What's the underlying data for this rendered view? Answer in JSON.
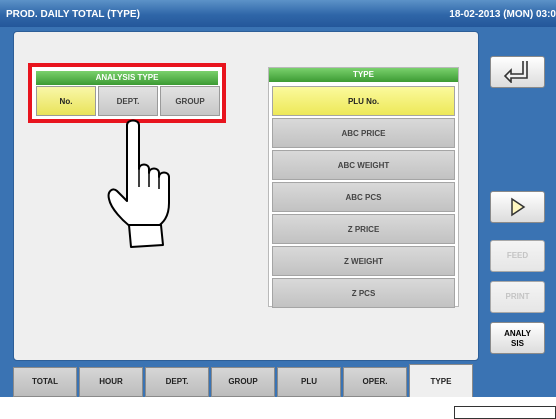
{
  "title": "PROD. DAILY TOTAL (TYPE)",
  "datetime": "18-02-2013 (MON) 03:0",
  "analysis": {
    "header": "ANALYSIS TYPE",
    "options": [
      {
        "label": "No.",
        "selected": true
      },
      {
        "label": "DEPT.",
        "selected": false
      },
      {
        "label": "GROUP",
        "selected": false
      }
    ]
  },
  "type_list": {
    "header": "TYPE",
    "items": [
      {
        "label": "PLU No.",
        "selected": true
      },
      {
        "label": "ABC PRICE",
        "selected": false
      },
      {
        "label": "ABC WEIGHT",
        "selected": false
      },
      {
        "label": "ABC PCS",
        "selected": false
      },
      {
        "label": "Z PRICE",
        "selected": false
      },
      {
        "label": "Z WEIGHT",
        "selected": false
      },
      {
        "label": "Z PCS",
        "selected": false
      }
    ]
  },
  "right_buttons": {
    "back_icon": "return-arrow-icon",
    "next_icon": "play-arrow-icon",
    "feed": "FEED",
    "print": "PRINT",
    "analysis_line1": "ANALY",
    "analysis_line2": "SIS"
  },
  "tabs": [
    "TOTAL",
    "HOUR",
    "DEPT.",
    "GROUP",
    "PLU",
    "OPER.",
    "TYPE"
  ],
  "active_tab": "TYPE",
  "colors": {
    "title_bar": "#2f66a8",
    "frame": "#3a73b3",
    "header_green": "#3c9a33",
    "selected_yellow": "#ede858",
    "highlight_red": "#e8141e"
  }
}
